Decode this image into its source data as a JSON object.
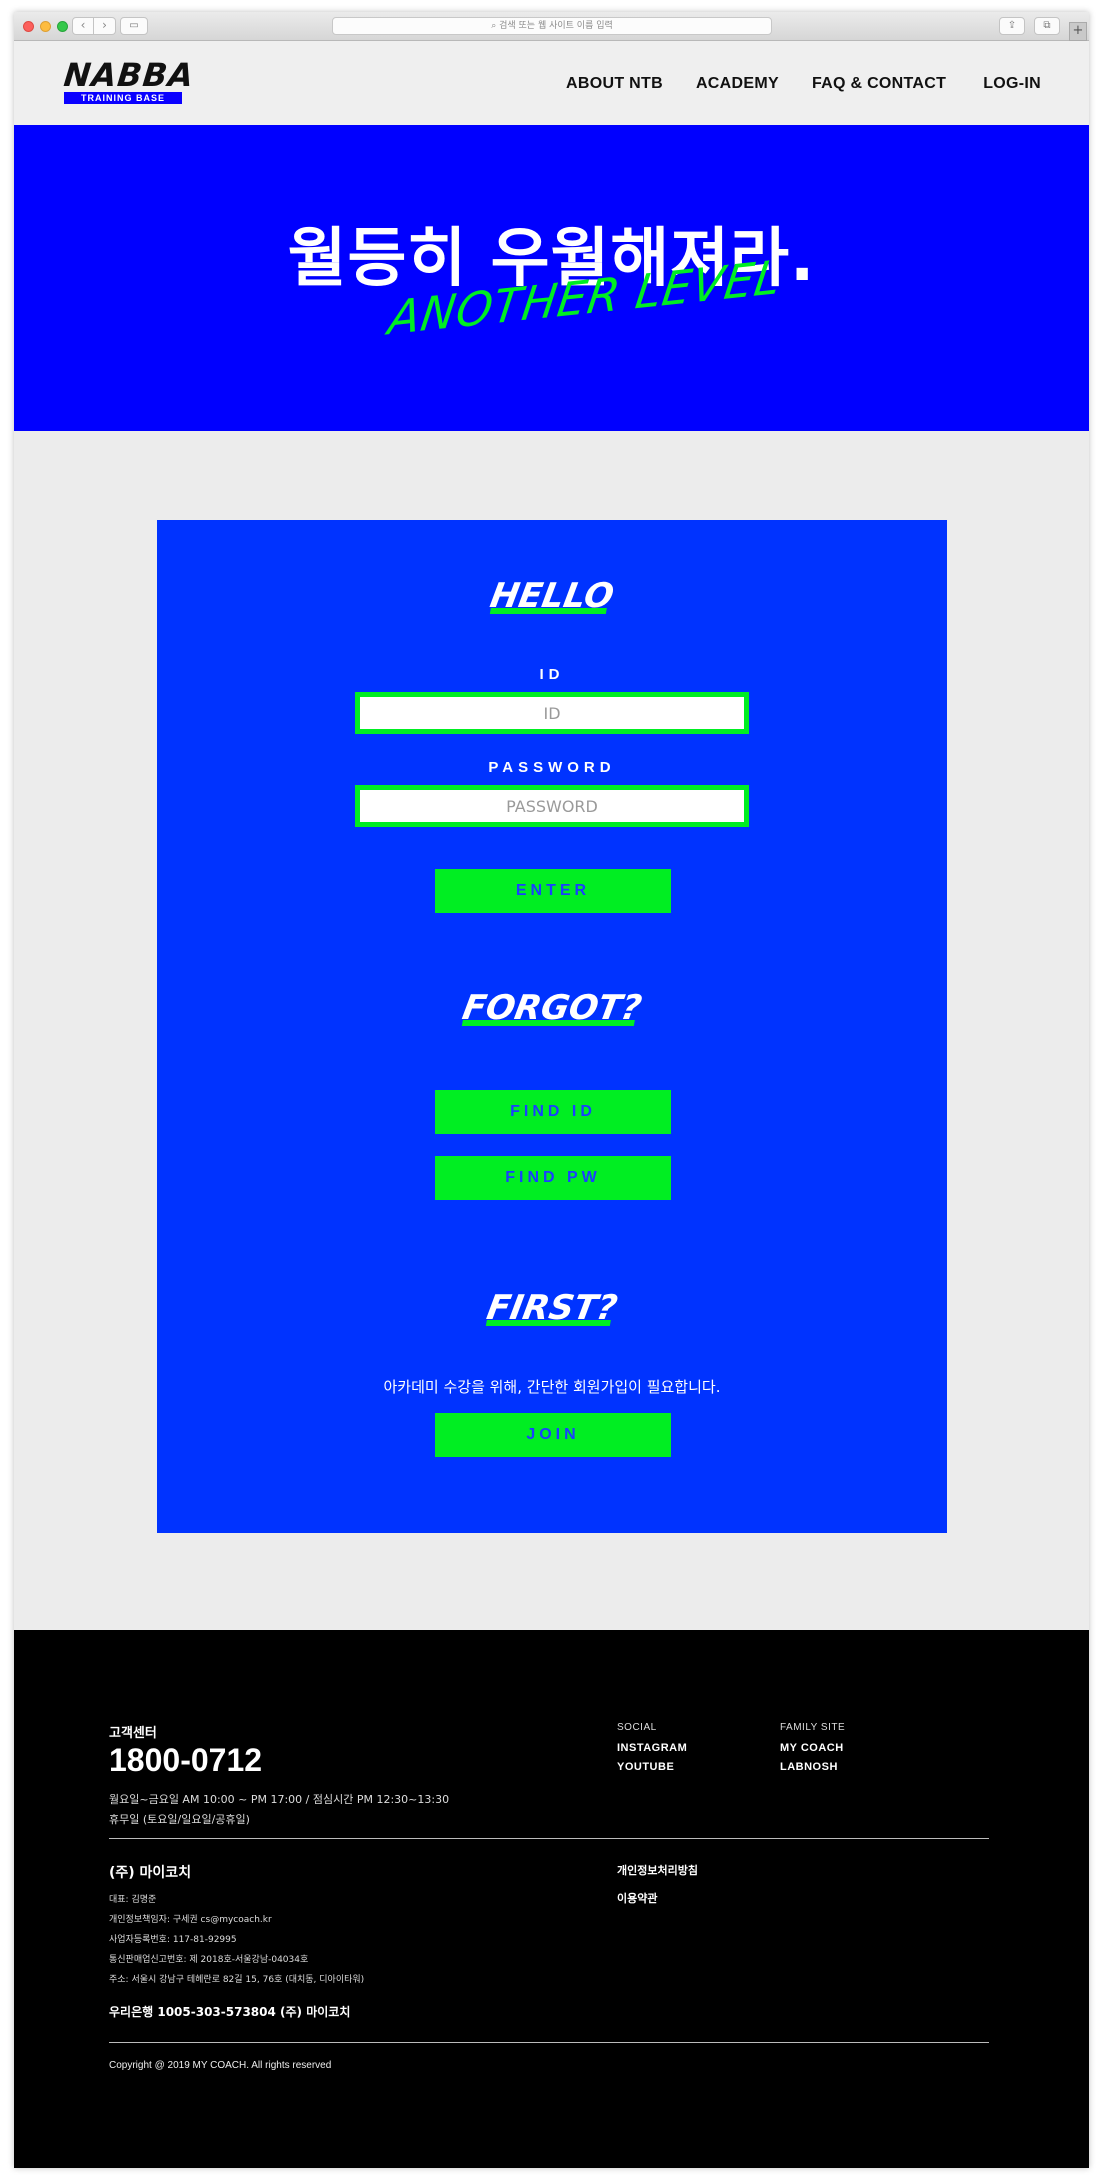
{
  "browser": {
    "address_placeholder": "검색 또는 웹 사이트 이름 입력",
    "back_glyph": "‹",
    "forward_glyph": "›",
    "sidebar_glyph": "▭",
    "share_glyph": "⇪",
    "tabs_glyph": "⧉",
    "newtab_glyph": "+"
  },
  "header": {
    "logo_main": "NABBA",
    "logo_sub": "TRAINING BASE",
    "nav": [
      "ABOUT NTB",
      "ACADEMY",
      "FAQ & CONTACT",
      "LOG-IN"
    ]
  },
  "hero": {
    "title": "월등히 우월해져라.",
    "subtitle": "ANOTHER LEVEL",
    "bg_color": "#0000ff",
    "accent_color": "#00ee22"
  },
  "login": {
    "hello_title": "HELLO",
    "id_label": "ID",
    "id_placeholder": "ID",
    "password_label": "PASSWORD",
    "password_placeholder": "PASSWORD",
    "enter_label": "ENTER",
    "forgot_title": "FORGOT?",
    "find_id_label": "FIND ID",
    "find_pw_label": "FIND PW",
    "first_title": "FIRST?",
    "join_note": "아카데미 수강을 위해, 간단한 회원가입이 필요합니다.",
    "join_label": "JOIN",
    "card_color": "#0033ff"
  },
  "footer": {
    "cs_label": "고객센터",
    "cs_phone": "1800-0712",
    "cs_hours": "월요일~금요일 AM 10:00 ~ PM 17:00 / 점심시간 PM 12:30~13:30",
    "cs_closed": "휴무일 (토요일/일요일/공휴일)",
    "social_head": "SOCIAL",
    "social_links": [
      "INSTAGRAM",
      "YOUTUBE"
    ],
    "family_head": "FAMILY SITE",
    "family_links": [
      "MY COACH",
      "LABNOSH"
    ],
    "company_name": "(주) 마이코치",
    "company_lines": [
      "대표: 김명준",
      "개인정보책임자: 구세권 cs@mycoach.kr",
      "사업자등록번호: 117-81-92995",
      "통신판매업신고번호: 제 2018호-서울강남-04034호",
      "주소: 서울시 강남구 테헤란로 82길 15, 76호 (대치동, 디아이타워)"
    ],
    "bank": "우리은행 1005-303-573804 (주) 마이코치",
    "privacy_policy": "개인정보처리방침",
    "terms": "이용약관",
    "copyright": "Copyright @ 2019 MY COACH. All rights reserved"
  }
}
